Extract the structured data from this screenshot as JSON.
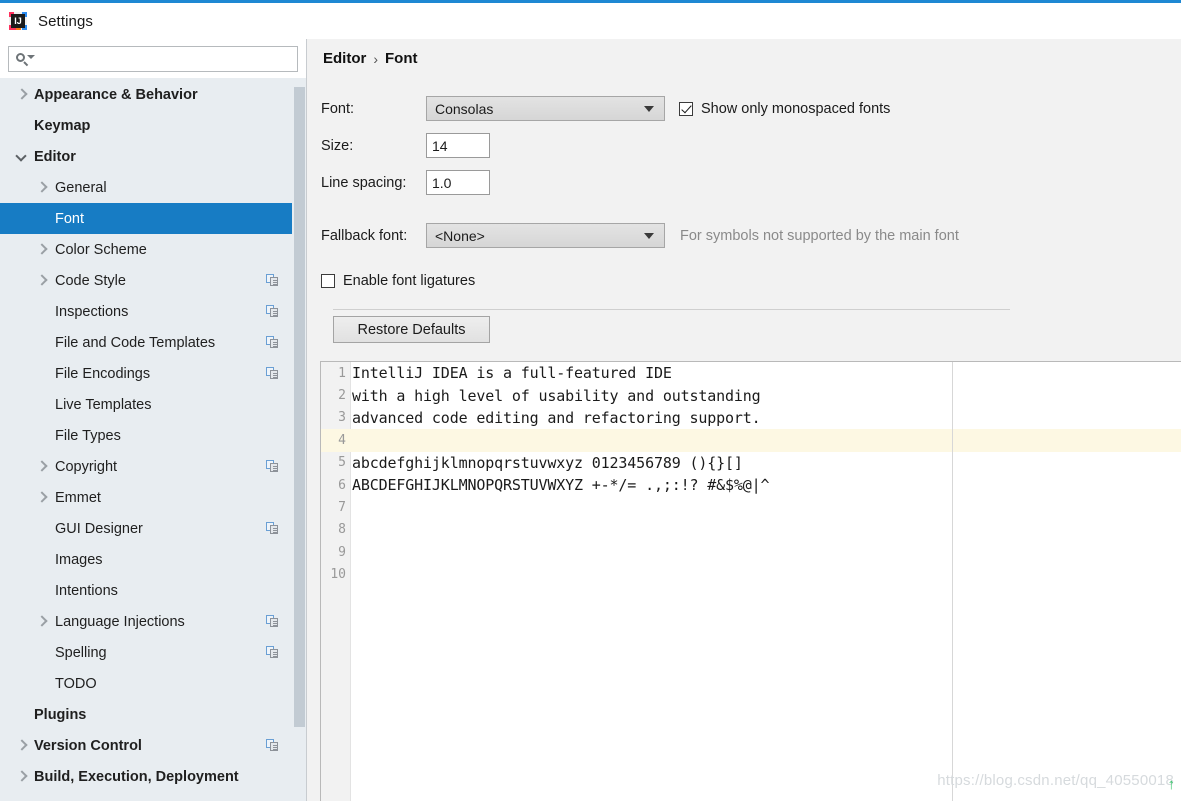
{
  "window": {
    "title": "Settings",
    "logo_icon": "intellij-idea-logo",
    "accent_color": "#1e88d3"
  },
  "search": {
    "icon": "search-icon",
    "value": "",
    "placeholder": ""
  },
  "sidebar": {
    "selection_color": "#177cc4",
    "items": [
      {
        "label": "Appearance & Behavior",
        "indent": 1,
        "arrow": "right",
        "bold": true,
        "badge": false,
        "selected": false
      },
      {
        "label": "Keymap",
        "indent": 1,
        "arrow": "none",
        "bold": true,
        "badge": false,
        "selected": false
      },
      {
        "label": "Editor",
        "indent": 1,
        "arrow": "down",
        "bold": true,
        "badge": false,
        "selected": false
      },
      {
        "label": "General",
        "indent": 2,
        "arrow": "right",
        "bold": false,
        "badge": false,
        "selected": false
      },
      {
        "label": "Font",
        "indent": 2,
        "arrow": "none",
        "bold": false,
        "badge": false,
        "selected": true
      },
      {
        "label": "Color Scheme",
        "indent": 2,
        "arrow": "right",
        "bold": false,
        "badge": false,
        "selected": false
      },
      {
        "label": "Code Style",
        "indent": 2,
        "arrow": "right",
        "bold": false,
        "badge": true,
        "selected": false
      },
      {
        "label": "Inspections",
        "indent": 2,
        "arrow": "none",
        "bold": false,
        "badge": true,
        "selected": false
      },
      {
        "label": "File and Code Templates",
        "indent": 2,
        "arrow": "none",
        "bold": false,
        "badge": true,
        "selected": false
      },
      {
        "label": "File Encodings",
        "indent": 2,
        "arrow": "none",
        "bold": false,
        "badge": true,
        "selected": false
      },
      {
        "label": "Live Templates",
        "indent": 2,
        "arrow": "none",
        "bold": false,
        "badge": false,
        "selected": false
      },
      {
        "label": "File Types",
        "indent": 2,
        "arrow": "none",
        "bold": false,
        "badge": false,
        "selected": false
      },
      {
        "label": "Copyright",
        "indent": 2,
        "arrow": "right",
        "bold": false,
        "badge": true,
        "selected": false
      },
      {
        "label": "Emmet",
        "indent": 2,
        "arrow": "right",
        "bold": false,
        "badge": false,
        "selected": false
      },
      {
        "label": "GUI Designer",
        "indent": 2,
        "arrow": "none",
        "bold": false,
        "badge": true,
        "selected": false
      },
      {
        "label": "Images",
        "indent": 2,
        "arrow": "none",
        "bold": false,
        "badge": false,
        "selected": false
      },
      {
        "label": "Intentions",
        "indent": 2,
        "arrow": "none",
        "bold": false,
        "badge": false,
        "selected": false
      },
      {
        "label": "Language Injections",
        "indent": 2,
        "arrow": "right",
        "bold": false,
        "badge": true,
        "selected": false
      },
      {
        "label": "Spelling",
        "indent": 2,
        "arrow": "none",
        "bold": false,
        "badge": true,
        "selected": false
      },
      {
        "label": "TODO",
        "indent": 2,
        "arrow": "none",
        "bold": false,
        "badge": false,
        "selected": false
      },
      {
        "label": "Plugins",
        "indent": 1,
        "arrow": "none",
        "bold": true,
        "badge": false,
        "selected": false
      },
      {
        "label": "Version Control",
        "indent": 1,
        "arrow": "right",
        "bold": true,
        "badge": true,
        "selected": false
      },
      {
        "label": "Build, Execution, Deployment",
        "indent": 1,
        "arrow": "right",
        "bold": true,
        "badge": false,
        "selected": false
      }
    ]
  },
  "main": {
    "breadcrumb": {
      "parent": "Editor",
      "separator": "›",
      "current": "Font"
    },
    "font_row": {
      "label": "Font:",
      "value": "Consolas"
    },
    "size_row": {
      "label": "Size:",
      "value": "14"
    },
    "spacing_row": {
      "label": "Line spacing:",
      "value": "1.0"
    },
    "fallback_row": {
      "label": "Fallback font:",
      "value": "<None>",
      "hint": "For symbols not supported by the main font"
    },
    "monospaced_checkbox": {
      "label": "Show only monospaced fonts",
      "checked": true
    },
    "ligatures_checkbox": {
      "label": "Enable font ligatures",
      "checked": false
    },
    "restore_button": "Restore Defaults"
  },
  "preview": {
    "highlight_color": "#fdf8e3",
    "lines": [
      {
        "num": "1",
        "text": "IntelliJ IDEA is a full-featured IDE",
        "highlight": false
      },
      {
        "num": "2",
        "text": "with a high level of usability and outstanding",
        "highlight": false
      },
      {
        "num": "3",
        "text": "advanced code editing and refactoring support.",
        "highlight": false
      },
      {
        "num": "4",
        "text": "",
        "highlight": true
      },
      {
        "num": "5",
        "text": "abcdefghijklmnopqrstuvwxyz 0123456789 (){}[]",
        "highlight": false
      },
      {
        "num": "6",
        "text": "ABCDEFGHIJKLMNOPQRSTUVWXYZ +-*/= .,;:!? #&$%@|^",
        "highlight": false
      },
      {
        "num": "7",
        "text": "",
        "highlight": false
      },
      {
        "num": "8",
        "text": "",
        "highlight": false
      },
      {
        "num": "9",
        "text": "",
        "highlight": false
      },
      {
        "num": "10",
        "text": "",
        "highlight": false
      }
    ]
  },
  "watermark": {
    "text": "https://blog.csdn.net/qq_40550018",
    "arrow": "↑"
  }
}
